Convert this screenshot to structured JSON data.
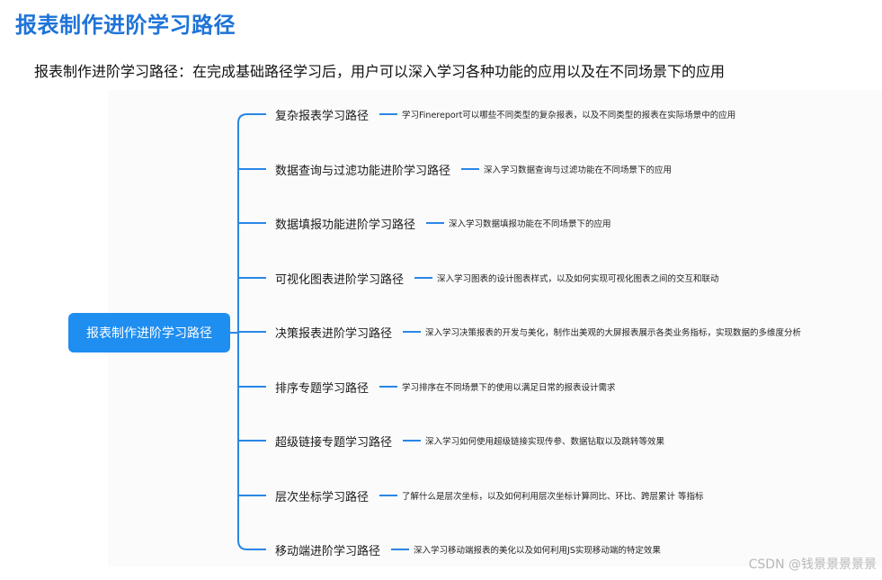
{
  "page_title": "报表制作进阶学习路径",
  "subtitle": "报表制作进阶学习路径：在完成基础路径学习后，用户可以深入学习各种功能的应用以及在不同场景下的应用",
  "root": {
    "label": "报表制作进阶学习路径",
    "color": "#1f8ef1"
  },
  "connector_color": "#2a86e6",
  "branches": [
    {
      "label": "复杂报表学习路径",
      "desc": "学习Finereport可以哪些不同类型的复杂报表，以及不同类型的报表在实际场景中的应用"
    },
    {
      "label": "数据查询与过滤功能进阶学习路径",
      "desc": "深入学习数据查询与过滤功能在不同场景下的应用"
    },
    {
      "label": "数据填报功能进阶学习路径",
      "desc": "深入学习数据填报功能在不同场景下的应用"
    },
    {
      "label": "可视化图表进阶学习路径",
      "desc": "深入学习图表的设计图表样式，以及如何实现可视化图表之间的交互和联动"
    },
    {
      "label": "决策报表进阶学习路径",
      "desc": "深入学习决策报表的开发与美化，制作出美观的大屏报表展示各类业务指标，实现数据的多维度分析"
    },
    {
      "label": "排序专题学习路径",
      "desc": "学习排序在不同场景下的使用以满足日常的报表设计需求"
    },
    {
      "label": "超级链接专题学习路径",
      "desc": "深入学习如何使用超级链接实现传参、数据钻取以及跳转等效果"
    },
    {
      "label": "层次坐标学习路径",
      "desc": "了解什么是层次坐标，以及如何利用层次坐标计算同比、环比、跨层累计 等指标"
    },
    {
      "label": "移动端进阶学习路径",
      "desc": "深入学习移动端报表的美化以及如何利用JS实现移动端的特定效果"
    }
  ],
  "watermark": "CSDN @钱景景景景景"
}
